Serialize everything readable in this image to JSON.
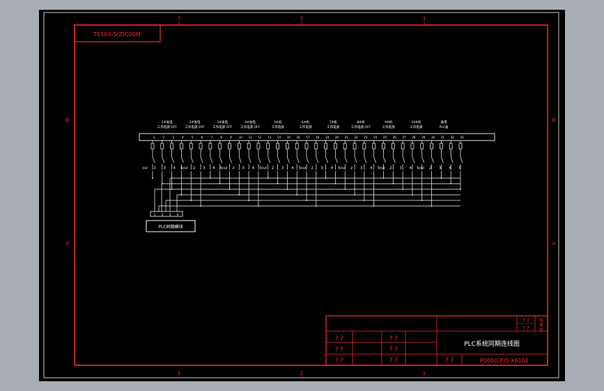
{
  "drawing_code": "T0103-S(Z)C00M",
  "column_markers": [
    "3",
    "2",
    "1"
  ],
  "row_markers": [
    "B",
    "A"
  ],
  "channel_groups": [
    {
      "top": "1#发电",
      "bottom": "工作电源 OFF"
    },
    {
      "top": "2#发电",
      "bottom": "工作电源 OFF"
    },
    {
      "top": "3#发电",
      "bottom": "工作电源 OFF"
    },
    {
      "top": "4#发电",
      "bottom": "工作电源 OFF"
    },
    {
      "top": "5#机",
      "bottom": "工作电源"
    },
    {
      "top": "6#机",
      "bottom": "工作电源"
    },
    {
      "top": "7#机",
      "bottom": "工作电源"
    },
    {
      "top": "8#机",
      "bottom": "工作电源 OFF"
    },
    {
      "top": "9#机",
      "bottom": "工作电源"
    },
    {
      "top": "10#机",
      "bottom": "工作电源"
    },
    {
      "top": "备用",
      "bottom": "PLC备"
    }
  ],
  "terminal_numbers": [
    "1",
    "2",
    "3",
    "4",
    "5",
    "6",
    "7",
    "8",
    "9",
    "10",
    "11",
    "12",
    "13",
    "14",
    "15",
    "16",
    "17",
    "18",
    "19",
    "20",
    "21",
    "22",
    "23",
    "24",
    "25",
    "26",
    "27",
    "28",
    "29",
    "30",
    "31",
    "32",
    "33"
  ],
  "switch_labels": [
    "cul",
    "2",
    "3",
    "4",
    "5cul",
    "2",
    "3",
    "4",
    "5cul",
    "2",
    "3",
    "4",
    "5cul",
    "2",
    "3",
    "4",
    "5cul",
    "2",
    "3",
    "4",
    "5cul",
    "2",
    "3",
    "4",
    "5cul",
    "2",
    "3",
    "4",
    "5cul",
    "2",
    "3",
    "4",
    "5"
  ],
  "plc_terminals": [
    "1",
    "2",
    "3",
    "4"
  ],
  "plc_box_label": "PLC同期模块",
  "title_block": {
    "drawing_title": "PLC系统同期连线图",
    "drawing_number": "P000(CF)S-X6101",
    "placeholder": "? ?",
    "corner_cells": [
      "? ?",
      "? ?",
      "? ?"
    ],
    "corner_labels": [
      "标",
      "准",
      "化"
    ]
  },
  "colors": {
    "frame": "#ff2a2a",
    "wiring": "#ffffff",
    "background": "#000000",
    "outer_border": "#c8c8c8"
  }
}
